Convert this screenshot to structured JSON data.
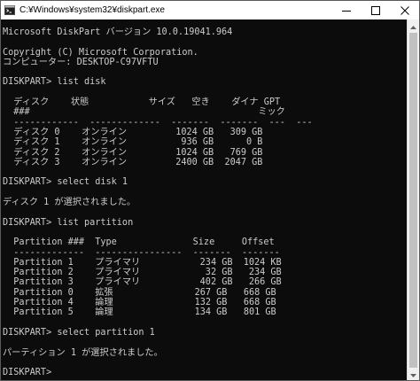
{
  "window": {
    "title": "C:¥Windows¥system32¥diskpart.exe",
    "icon": "console-icon",
    "controls": {
      "minimize": "minimize-icon",
      "maximize": "maximize-icon",
      "close": "close-icon"
    },
    "colors": {
      "background": "#0c0c0c",
      "text": "#cccccc",
      "titlebar": "#ffffff"
    }
  },
  "console": {
    "lines": [
      "Microsoft DiskPart バージョン 10.0.19041.964",
      "",
      "Copyright (C) Microsoft Corporation.",
      "コンピューター: DESKTOP-C97VFTU",
      "",
      "DISKPART> list disk",
      "",
      "  ディスク    状態           サイズ   空き    ダイナ GPT",
      "  ###                                          ミック",
      "  ------------  -------------  -------  -------  ---  ---",
      "  ディスク 0    オンライン         1024 GB   309 GB",
      "  ディスク 1    オンライン          936 GB      0 B",
      "  ディスク 2    オンライン         1024 GB   769 GB",
      "  ディスク 3    オンライン         2400 GB  2047 GB",
      "",
      "DISKPART> select disk 1",
      "",
      "ディスク 1 が選択されました。",
      "",
      "DISKPART> list partition",
      "",
      "  Partition ###  Type              Size     Offset",
      "  -------------  ----------------  -------  -------",
      "  Partition 1    プライマリ           234 GB  1024 KB",
      "  Partition 2    プライマリ            32 GB   234 GB",
      "  Partition 3    プライマリ           402 GB   266 GB",
      "  Partition 0    拡張               267 GB   668 GB",
      "  Partition 4    論理               132 GB   668 GB",
      "  Partition 5    論理               134 GB   801 GB",
      "",
      "DISKPART> select partition 1",
      "",
      "パーティション 1 が選択されました。",
      "",
      "DISKPART> "
    ]
  }
}
